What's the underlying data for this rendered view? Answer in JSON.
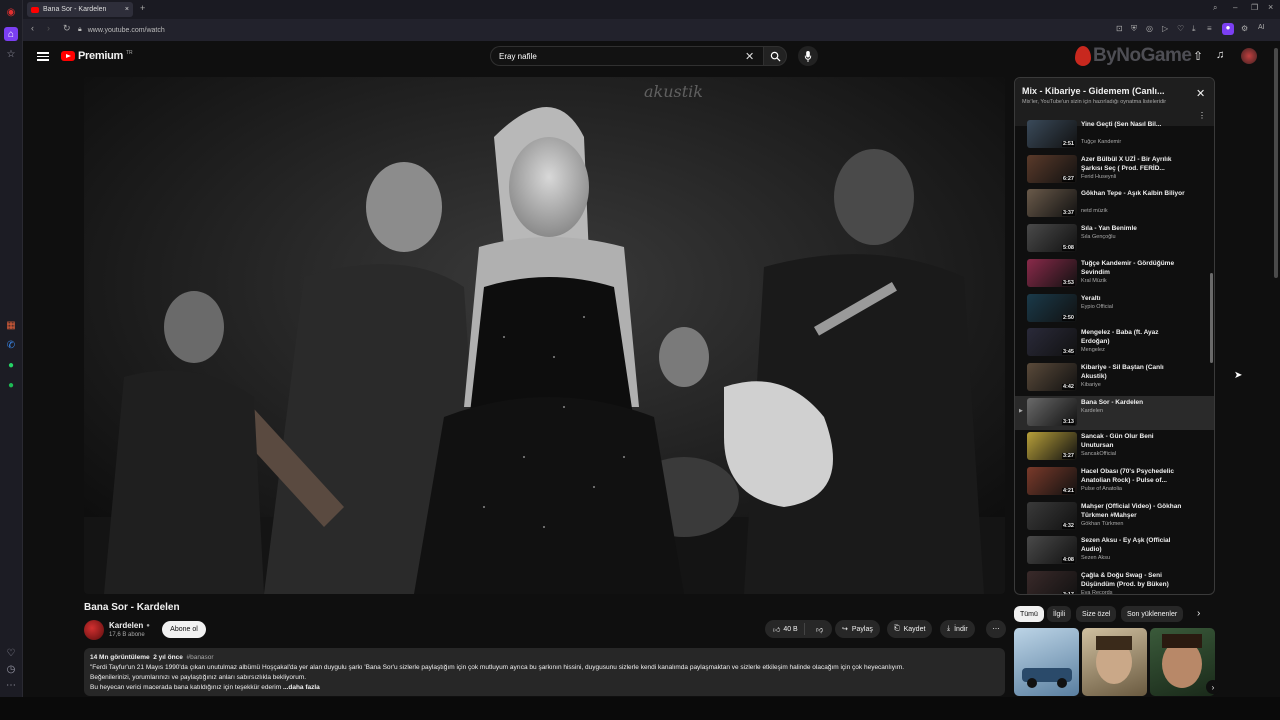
{
  "browser": {
    "tab_title": "Bana Sor - Kardelen",
    "url": "www.youtube.com/watch",
    "new_tab_label": "+",
    "ai_label": "AI"
  },
  "header": {
    "brand": "Premium",
    "brand_suffix": "TR",
    "search_value": "Eray nafile",
    "watermark": "ByNoGame"
  },
  "video": {
    "title": "Bana Sor - Kardelen",
    "channel": "Kardelen",
    "subscribers": "17,6 B abone",
    "subscribe_label": "Abone ol",
    "likes": "40 B",
    "share_label": "Paylaş",
    "save_label": "Kaydet",
    "download_label": "İndir"
  },
  "description": {
    "views": "14 Mn görüntüleme",
    "age": "2 yıl önce",
    "hashtag": "#banasor",
    "line1": "\"Ferdi Tayfur'un 21 Mayıs 1990'da çıkan unutulmaz albümü Hoşçakal'da yer alan duygulu şarkı 'Bana Sor'u sizlerle paylaştığım için çok mutluyum ayrıca bu şarkının hissini, duygusunu sizlerle kendi kanalımda paylaşmaktan ve sizlerle etkileşim halinde olacağım için çok heyecanlıyım.",
    "line2": "Beğenilerinizi, yorumlarınızı ve paylaştığınız anları sabırsızlıkla bekliyorum.",
    "line3": "Bu heyecan verici macerada bana katıldığınız için teşekkür ederim",
    "more": "...daha fazla"
  },
  "playlist": {
    "title": "Mix - Kibariye - Gidemem (Canlı...",
    "subtitle": "Mix'ler, YouTube'un sizin için hazırladığı oynatma listeleridir",
    "items": [
      {
        "title": "Yine Geçti (Sen Nasıl Bil...",
        "channel": "Tuğçe Kandemir",
        "duration": "2:51",
        "color": "#3a4a5a"
      },
      {
        "title": "Azer Bülbül X UZİ - Bir Ayrılık Şarkısı Seç ( Prod. FERİD...",
        "channel": "Ferid Huseynli",
        "duration": "6:27",
        "color": "#5a3a2a"
      },
      {
        "title": "Gökhan Tepe - Aşık Kalbin Biliyor",
        "channel": "netd müzik",
        "duration": "3:37",
        "color": "#6a5a4a"
      },
      {
        "title": "Sıla - Yan Benimle",
        "channel": "Sıla Gençoğlu",
        "duration": "5:08",
        "color": "#4a4a4a"
      },
      {
        "title": "Tuğçe Kandemir - Gördüğüme Sevindim",
        "channel": "Kral Müzik",
        "duration": "3:53",
        "color": "#8a2a4a"
      },
      {
        "title": "Yeraltı",
        "channel": "Eypio Official",
        "duration": "2:50",
        "color": "#1a3a4a"
      },
      {
        "title": "Mengelez - Baba (ft. Ayaz Erdoğan)",
        "channel": "Mengelez",
        "duration": "3:45",
        "color": "#2a2a3a"
      },
      {
        "title": "Kibariye - Sil Baştan (Canlı Akustik)",
        "channel": "Kibariye",
        "duration": "4:42",
        "color": "#5a4a3a"
      },
      {
        "title": "Bana Sor - Kardelen",
        "channel": "Kardelen",
        "duration": "3:13",
        "color": "#6a6a6a"
      },
      {
        "title": "Sancak - Gün Olur Beni Unutursan",
        "channel": "SancakOfficial",
        "duration": "3:27",
        "color": "#b8a03a"
      },
      {
        "title": "Hacel Obası (70's Psychedelic Anatolian Rock) - Pulse of...",
        "channel": "Pulse of Anatolia",
        "duration": "4:21",
        "color": "#7a3a2a"
      },
      {
        "title": "Mahşer (Official Video) - Gökhan Türkmen #Mahşer",
        "channel": "Gökhan Türkmen",
        "duration": "4:32",
        "color": "#3a3a3a"
      },
      {
        "title": "Sezen Aksu - Ey Aşk (Official Audio)",
        "channel": "Sezen Aksu",
        "duration": "4:08",
        "color": "#4a4a4a"
      },
      {
        "title": "Çağla & Doğu Swag - Seni Düşündüm (Prod. by Büken)",
        "channel": "Eva Records",
        "duration": "3:17",
        "color": "#3a2a2a"
      }
    ]
  },
  "chips": [
    "Tümü",
    "İlgili",
    "Size özel",
    "Son yüklenenler"
  ],
  "colors": {
    "background": "#0f0f0f",
    "accent_red": "#ff0000",
    "chip_selected": "#f1f1f1"
  }
}
